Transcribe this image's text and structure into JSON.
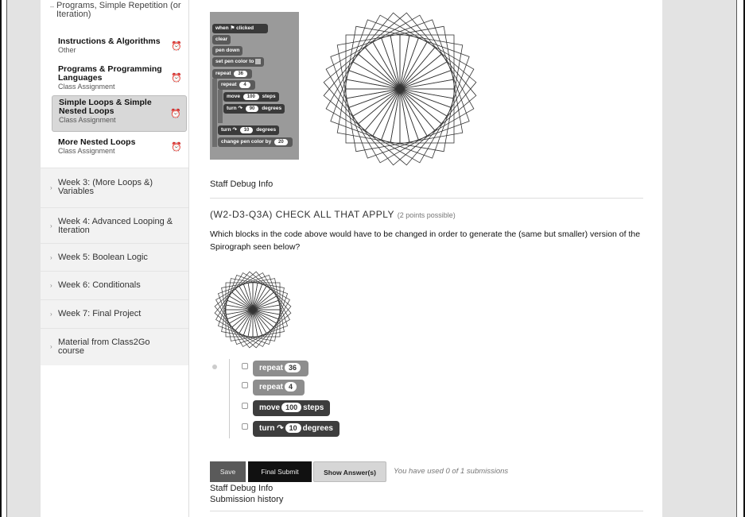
{
  "sidebar": {
    "top_item": "Programs, Simple Repetition (or Iteration)",
    "lessons": [
      {
        "title": "Instructions & Algorithms",
        "subtitle": "Other"
      },
      {
        "title": "Programs & Programming Languages",
        "subtitle": "Class Assignment"
      },
      {
        "title": "Simple Loops & Simple Nested Loops",
        "subtitle": "Class Assignment"
      },
      {
        "title": "More Nested Loops",
        "subtitle": "Class Assignment"
      }
    ],
    "weeks": [
      "Week 3: (More Loops &) Variables",
      "Week 4: Advanced Looping & Iteration",
      "Week 5: Boolean Logic",
      "Week 6: Conditionals",
      "Week 7: Final Project",
      "Material from Class2Go course"
    ]
  },
  "scratch_program": {
    "when_clicked": "when",
    "when_clicked_tail": "clicked",
    "clear": "clear",
    "pen_down": "pen down",
    "set_pen_color": "set pen color to",
    "repeat_outer": "repeat",
    "repeat_outer_n": "36",
    "repeat_inner": "repeat",
    "repeat_inner_n": "4",
    "move": "move",
    "move_n": "100",
    "move_tail": "steps",
    "turn1": "turn",
    "turn1_n": "90",
    "turn1_tail": "degrees",
    "turn2": "turn",
    "turn2_n": "10",
    "turn2_tail": "degrees",
    "change_pen": "change pen color by",
    "change_pen_n": "20"
  },
  "staff_debug": "Staff Debug Info",
  "question": {
    "id": "(W2-D3-Q3A) CHECK ALL THAT APPLY",
    "points": "(2 points possible)",
    "text": "Which blocks in the code above would have to be changed in order to generate the (same but smaller) version of the Spirograph seen below?"
  },
  "options": [
    {
      "label": "repeat",
      "value": "36",
      "tail": ""
    },
    {
      "label": "repeat",
      "value": "4",
      "tail": ""
    },
    {
      "label": "move",
      "value": "100",
      "tail": "steps"
    },
    {
      "label": "turn ↷",
      "value": "10",
      "tail": "degrees"
    }
  ],
  "buttons": {
    "save": "Save",
    "final_submit": "Final Submit",
    "show_answers": "Show Answer(s)"
  },
  "submissions_text": "You have used 0 of 1 submissions",
  "staff_debug_2": "Staff Debug Info",
  "submission_history": "Submission history",
  "spirograph": {
    "squares": 36,
    "rotation_step_degrees": 10
  }
}
